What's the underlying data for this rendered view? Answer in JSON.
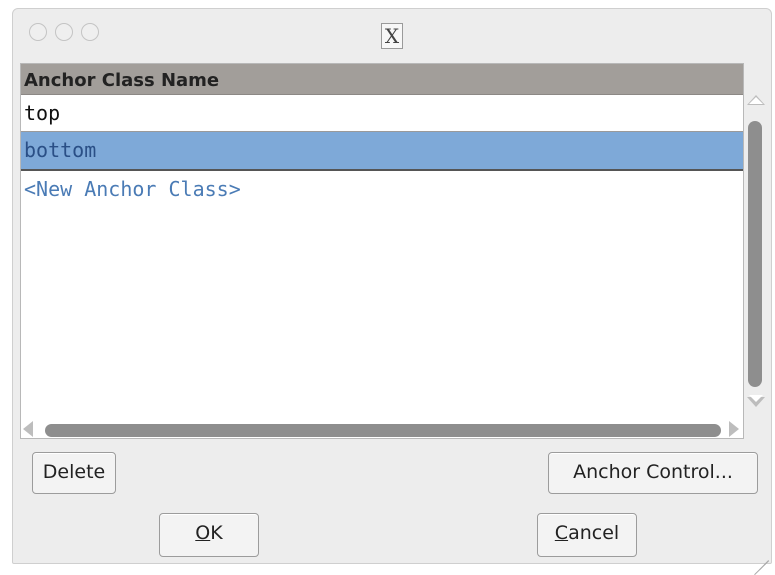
{
  "window": {
    "title_icon": "X"
  },
  "list": {
    "column_header": "Anchor Class Name",
    "rows": [
      "top",
      "bottom",
      "<New Anchor Class>"
    ],
    "selected_index": 1,
    "selection_color": "#7ea9d8"
  },
  "buttons": {
    "delete": "Delete",
    "anchor_control": "Anchor Control...",
    "ok_mnemonic": "O",
    "ok_rest": "K",
    "cancel_mnemonic": "C",
    "cancel_rest": "ancel"
  },
  "colors": {
    "header_bg": "#a29e9a",
    "new_entry_text": "#4a7bb5"
  }
}
